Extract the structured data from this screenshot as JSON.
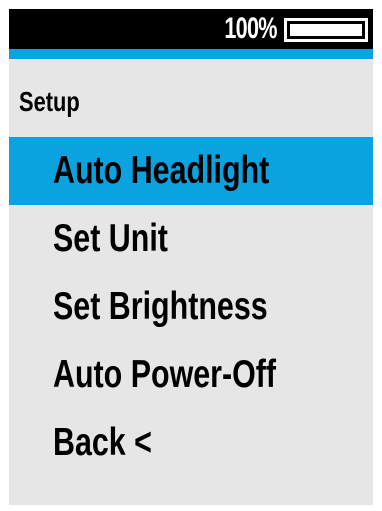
{
  "status_bar": {
    "battery_text": "100%",
    "battery_level": 1.0
  },
  "screen": {
    "title": "Setup"
  },
  "menu": {
    "selected_index": 0,
    "items": [
      {
        "label": "Auto Headlight"
      },
      {
        "label": "Set Unit"
      },
      {
        "label": "Set Brightness"
      },
      {
        "label": "Auto Power-Off"
      },
      {
        "label": "Back <"
      }
    ]
  },
  "colors": {
    "accent": "#0aa3e0",
    "status_bar_bg": "#000000",
    "screen_bg": "#e6e6e6"
  }
}
